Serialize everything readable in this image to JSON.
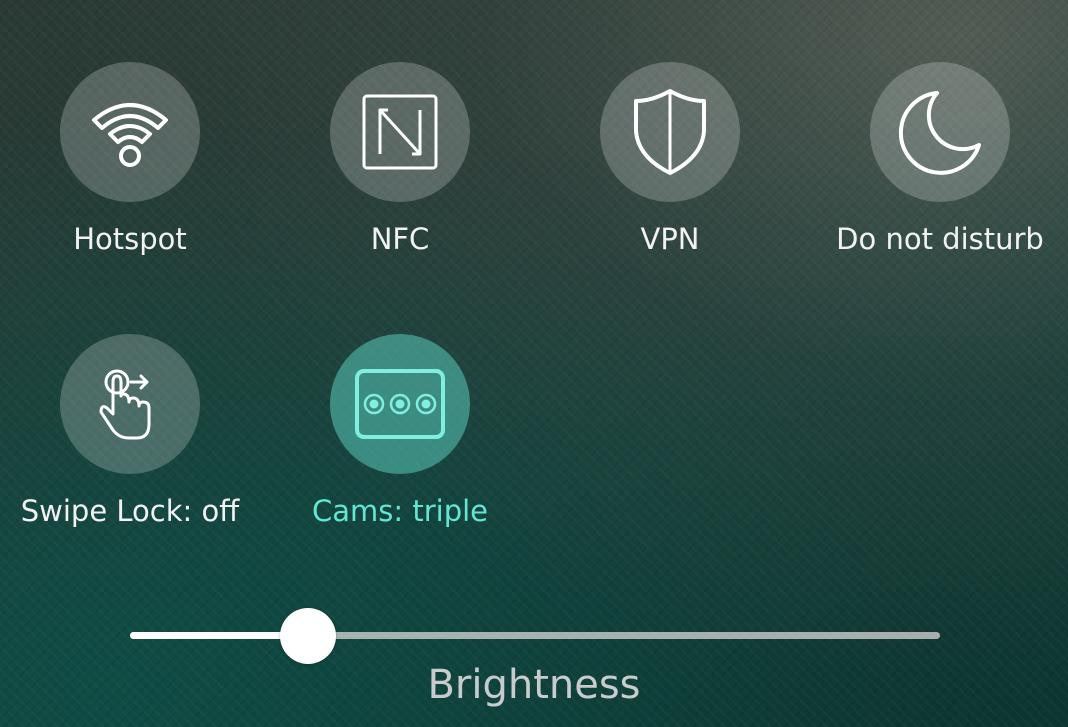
{
  "tiles": [
    {
      "label": "Hotspot",
      "icon": "wifi-hotspot-icon",
      "active": false
    },
    {
      "label": "NFC",
      "icon": "nfc-icon",
      "active": false
    },
    {
      "label": "VPN",
      "icon": "shield-icon",
      "active": false
    },
    {
      "label": "Do not disturb",
      "icon": "moon-icon",
      "active": false
    },
    {
      "label": "Swipe Lock: off",
      "icon": "swipe-gesture-icon",
      "active": false
    },
    {
      "label": "Cams: triple",
      "icon": "triple-camera-icon",
      "active": true
    }
  ],
  "brightness": {
    "label": "Brightness",
    "value": 0.22
  },
  "colors": {
    "accent": "#63e6d4",
    "tile_bg": "rgba(255,255,255,0.22)",
    "active_tile_bg": "rgba(90,200,185,0.55)"
  }
}
